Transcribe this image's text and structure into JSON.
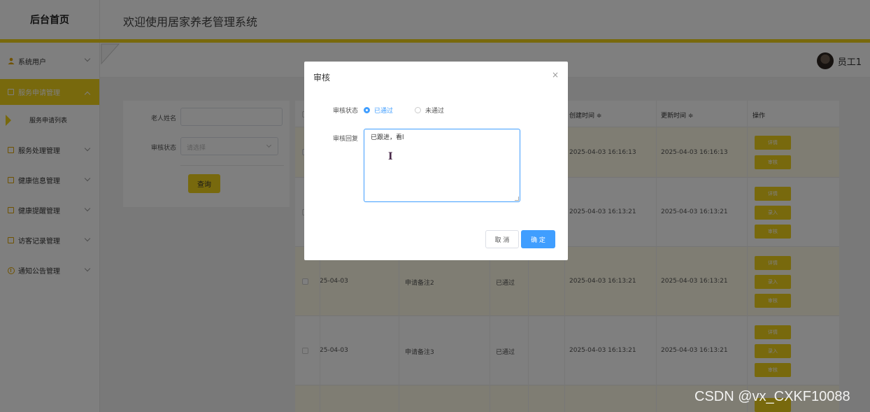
{
  "header": {
    "logo": "后台首页",
    "title": "欢迎使用居家养老管理系统"
  },
  "sidebar": {
    "items": [
      {
        "label": "系统用户",
        "icon": "user-icon"
      },
      {
        "label": "服务申请管理",
        "icon": "edit-icon",
        "active": true
      },
      {
        "label": "服务申请列表",
        "icon": "triangle-icon",
        "sub": true
      },
      {
        "label": "服务处理管理",
        "icon": "edit-icon"
      },
      {
        "label": "健康信息管理",
        "icon": "edit-icon"
      },
      {
        "label": "健康提醒管理",
        "icon": "edit-icon"
      },
      {
        "label": "访客记录管理",
        "icon": "edit-icon"
      },
      {
        "label": "通知公告管理",
        "icon": "info-icon"
      }
    ]
  },
  "user": {
    "name": "员工1"
  },
  "search": {
    "name_label": "老人姓名",
    "status_label": "审核状态",
    "status_placeholder": "请选择",
    "query_button": "查询"
  },
  "table": {
    "headers": {
      "created": "创建时间 ≑",
      "updated": "更新时间 ≑",
      "actions": "操作"
    },
    "rows": [
      {
        "date": "",
        "remark": "",
        "status": "",
        "created": "2025-04-03 16:16:13",
        "updated": "2025-04-03 16:16:13",
        "actions": [
          "详情",
          "审核"
        ]
      },
      {
        "date": "",
        "remark": "",
        "status": "",
        "created": "2025-04-03 16:13:21",
        "updated": "2025-04-03 16:13:21",
        "actions": [
          "详情",
          "录入",
          "审核"
        ]
      },
      {
        "date": "25-04-03",
        "remark": "申请备注2",
        "status": "已通过",
        "created": "2025-04-03 16:13:21",
        "updated": "2025-04-03 16:13:21",
        "actions": [
          "详情",
          "录入",
          "审核"
        ]
      },
      {
        "date": "25-04-03",
        "remark": "申请备注3",
        "status": "已通过",
        "created": "2025-04-03 16:13:21",
        "updated": "2025-04-03 16:13:21",
        "actions": [
          "详情",
          "录入",
          "审核"
        ]
      }
    ]
  },
  "dialog": {
    "title": "审核",
    "close": "×",
    "status_label": "审核状态",
    "options": [
      "已通过",
      "未通过"
    ],
    "selected": "已通过",
    "reply_label": "审核回复",
    "reply_value": "已跟进，看l",
    "cancel": "取 消",
    "confirm": "确 定"
  },
  "watermark": "CSDN @vx_CXKF10088",
  "colors": {
    "accent": "#f1d21a",
    "primary": "#409eff"
  }
}
